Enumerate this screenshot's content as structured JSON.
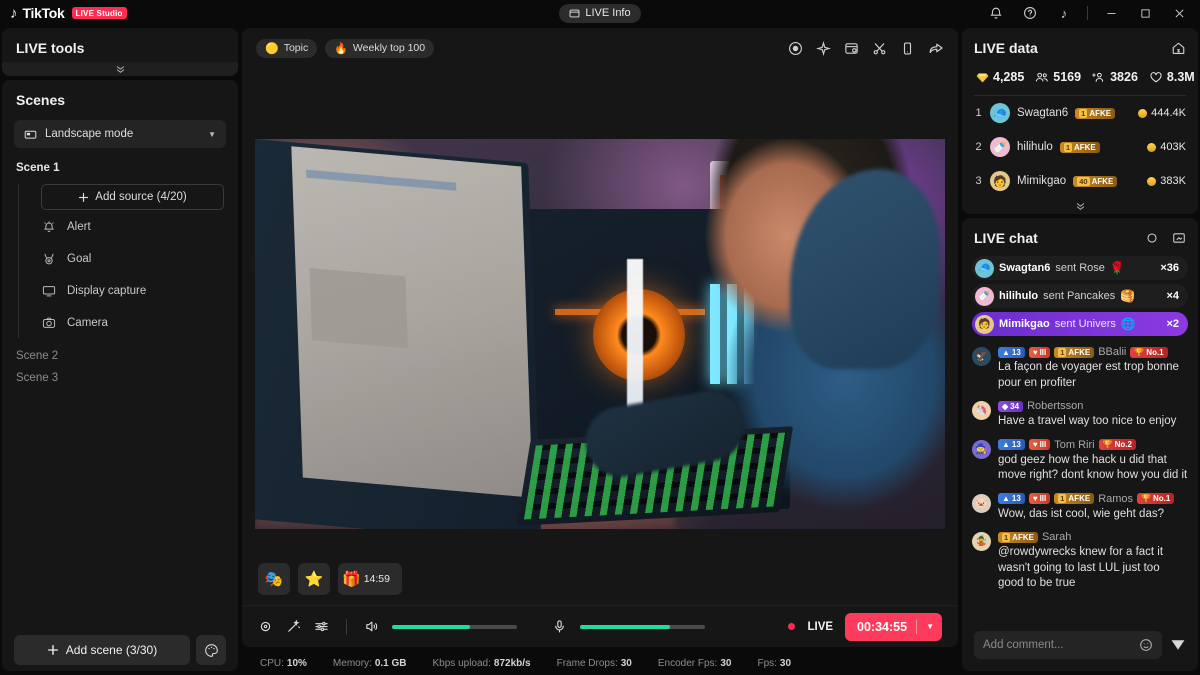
{
  "titlebar": {
    "brand": "TikTok",
    "badge": "LIVE Studio",
    "live_info": "LIVE Info",
    "icons": {
      "bell": "bell-icon",
      "help": "help-icon",
      "tiktok": "tiktok-icon"
    },
    "window": {
      "minimize": "—",
      "maximize": "▢",
      "close": "✕"
    }
  },
  "sidebar": {
    "live_tools_title": "LIVE tools",
    "scenes_title": "Scenes",
    "mode": "Landscape mode",
    "scene1_label": "Scene 1",
    "add_source": "Add source (4/20)",
    "sources": [
      {
        "label": "Alert",
        "icon": "alert-bell-icon"
      },
      {
        "label": "Goal",
        "icon": "goal-medal-icon"
      },
      {
        "label": "Display capture",
        "icon": "display-capture-icon"
      },
      {
        "label": "Camera",
        "icon": "camera-icon"
      }
    ],
    "scene2_label": "Scene 2",
    "scene3_label": "Scene 3",
    "add_scene": "Add scene (3/30)",
    "theme_icon": "palette-icon"
  },
  "stage": {
    "chips": [
      {
        "label": "Topic",
        "icon": "topic-icon"
      },
      {
        "label": "Weekly top 100",
        "icon": "fire-icon"
      }
    ],
    "top_icons": [
      "record-icon",
      "effects-sparkle-icon",
      "screenshot-icon",
      "scissors-icon",
      "mobile-icon",
      "share-icon"
    ],
    "source_thumbs": [
      {
        "icon": "mask-icon",
        "label": ""
      },
      {
        "icon": "star-icon",
        "label": ""
      },
      {
        "icon": "gift-icon",
        "label": "14:59"
      }
    ],
    "controls": {
      "settings_icon": "gear-icon",
      "magic_icon": "magic-wand-icon",
      "mixer_icon": "audio-mixer-icon",
      "speaker_icon": "speaker-icon",
      "mic_icon": "microphone-icon",
      "speaker_level": 62,
      "mic_level": 72,
      "live_label": "LIVE",
      "timer": "00:34:55"
    }
  },
  "statusbar": [
    {
      "label": "CPU:",
      "value": "10%"
    },
    {
      "label": "Memory:",
      "value": "0.1 GB"
    },
    {
      "label": "Kbps upload:",
      "value": "872kb/s"
    },
    {
      "label": "Frame Drops:",
      "value": "30"
    },
    {
      "label": "Encoder Fps:",
      "value": "30"
    },
    {
      "label": "Fps:",
      "value": "30"
    }
  ],
  "live_data": {
    "title": "LIVE data",
    "home_icon": "house-icon",
    "stats": [
      {
        "icon": "diamond-icon",
        "value": "4,285"
      },
      {
        "icon": "viewers-icon",
        "value": "5169"
      },
      {
        "icon": "follower-icon",
        "value": "3826"
      },
      {
        "icon": "heart-icon",
        "value": "8.3M"
      }
    ],
    "ranking": [
      {
        "rank": "1",
        "name": "Swagtan6",
        "badge_level": "1",
        "badge_text": "AFKE",
        "coins": "444.4K",
        "avatar": "🧢",
        "avatar_bg": "#6fc3d6"
      },
      {
        "rank": "2",
        "name": "hilihulo",
        "badge_level": "1",
        "badge_text": "AFKE",
        "coins": "403K",
        "avatar": "🍼",
        "avatar_bg": "#f3b8d4"
      },
      {
        "rank": "3",
        "name": "Mimikgao",
        "badge_level": "40",
        "badge_text": "AFKE",
        "coins": "383K",
        "avatar": "🧑",
        "avatar_bg": "#e6c98a"
      }
    ],
    "collapse_icon": "chevron-down-icon"
  },
  "live_chat": {
    "title": "LIVE chat",
    "head_icons": [
      "settings-ring-icon",
      "popout-icon"
    ],
    "gifts": [
      {
        "name": "Swagtan6",
        "action": "sent Rose",
        "gift_icon": "🌹",
        "count": "×36",
        "avatar": "🧢",
        "avatar_bg": "#6fc3d6",
        "highlight": false
      },
      {
        "name": "hilihulo",
        "action": "sent Pancakes",
        "gift_icon": "🥞",
        "count": "×4",
        "avatar": "🍼",
        "avatar_bg": "#f3b8d4",
        "highlight": false
      },
      {
        "name": "Mimikgao",
        "action": "sent Univers",
        "gift_icon": "🌐",
        "count": "×2",
        "avatar": "🧑",
        "avatar_bg": "#e6c98a",
        "highlight": true
      }
    ],
    "messages": [
      {
        "avatar": "🦅",
        "avatar_bg": "#2b4a63",
        "badges": [
          {
            "type": "level",
            "icon": "▲",
            "text": "13"
          },
          {
            "type": "heart",
            "icon": "♥",
            "text": "III"
          },
          {
            "type": "afke",
            "level": "1",
            "text": "AFKE"
          }
        ],
        "name": "BBalii",
        "rank_badge": "No.1",
        "text": "La façon de voyager est trop bonne pour en profiter"
      },
      {
        "avatar": "🦄",
        "avatar_bg": "#f0d2a8",
        "badges": [
          {
            "type": "gem",
            "icon": "◆",
            "text": "34"
          }
        ],
        "name": "Robertsson",
        "rank_badge": "",
        "text": "Have a travel way too nice to enjoy"
      },
      {
        "avatar": "🧙",
        "avatar_bg": "#7a6bd0",
        "badges": [
          {
            "type": "level",
            "icon": "▲",
            "text": "13"
          },
          {
            "type": "heart",
            "icon": "♥",
            "text": "III"
          }
        ],
        "name": "Tom Riri",
        "rank_badge": "No.2",
        "text": "god geez how the hack u did that move right? dont know how you did it"
      },
      {
        "avatar": "🐷",
        "avatar_bg": "#d8cfc2",
        "badges": [
          {
            "type": "level",
            "icon": "▲",
            "text": "13"
          },
          {
            "type": "heart",
            "icon": "♥",
            "text": "III"
          },
          {
            "type": "afke",
            "level": "1",
            "text": "AFKE"
          }
        ],
        "name": "Ramos",
        "rank_badge": "No.1",
        "text": "Wow, das ist cool, wie geht das?"
      },
      {
        "avatar": "🤹",
        "avatar_bg": "#e3d3b0",
        "badges": [
          {
            "type": "afke",
            "level": "1",
            "text": "AFKE"
          }
        ],
        "name": "Sarah",
        "rank_badge": "",
        "text": "@rowdywrecks knew for a fact it wasn't going to last LUL just too good to be true"
      }
    ],
    "input_placeholder": "Add comment...",
    "emoji_icon": "emoji-icon",
    "send_icon": "send-icon"
  },
  "colors": {
    "brand_pink": "#fe2c55",
    "accent_green": "#22dba0",
    "panel_bg": "#161616",
    "app_bg": "#0a0a0a",
    "highlight_purple": "#7b33d8"
  }
}
